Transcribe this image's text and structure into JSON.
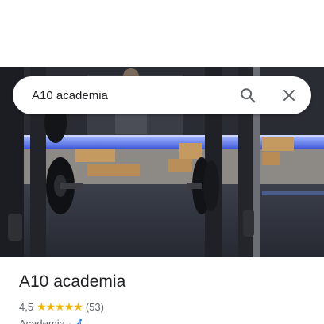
{
  "search": {
    "query": "A10 academia"
  },
  "place": {
    "name": "A10 academia",
    "rating": "4,5",
    "stars": "★★★★★",
    "review_count": "(53)",
    "category": "Academia",
    "separator": "·"
  },
  "icons": {
    "search": "search-icon",
    "close": "close-icon",
    "accessibility": "wheelchair-accessible-icon",
    "photo": "place-photo"
  },
  "colors": {
    "star": "#f4b400",
    "accessible": "#1a73e8",
    "led": "#6f8dff"
  }
}
